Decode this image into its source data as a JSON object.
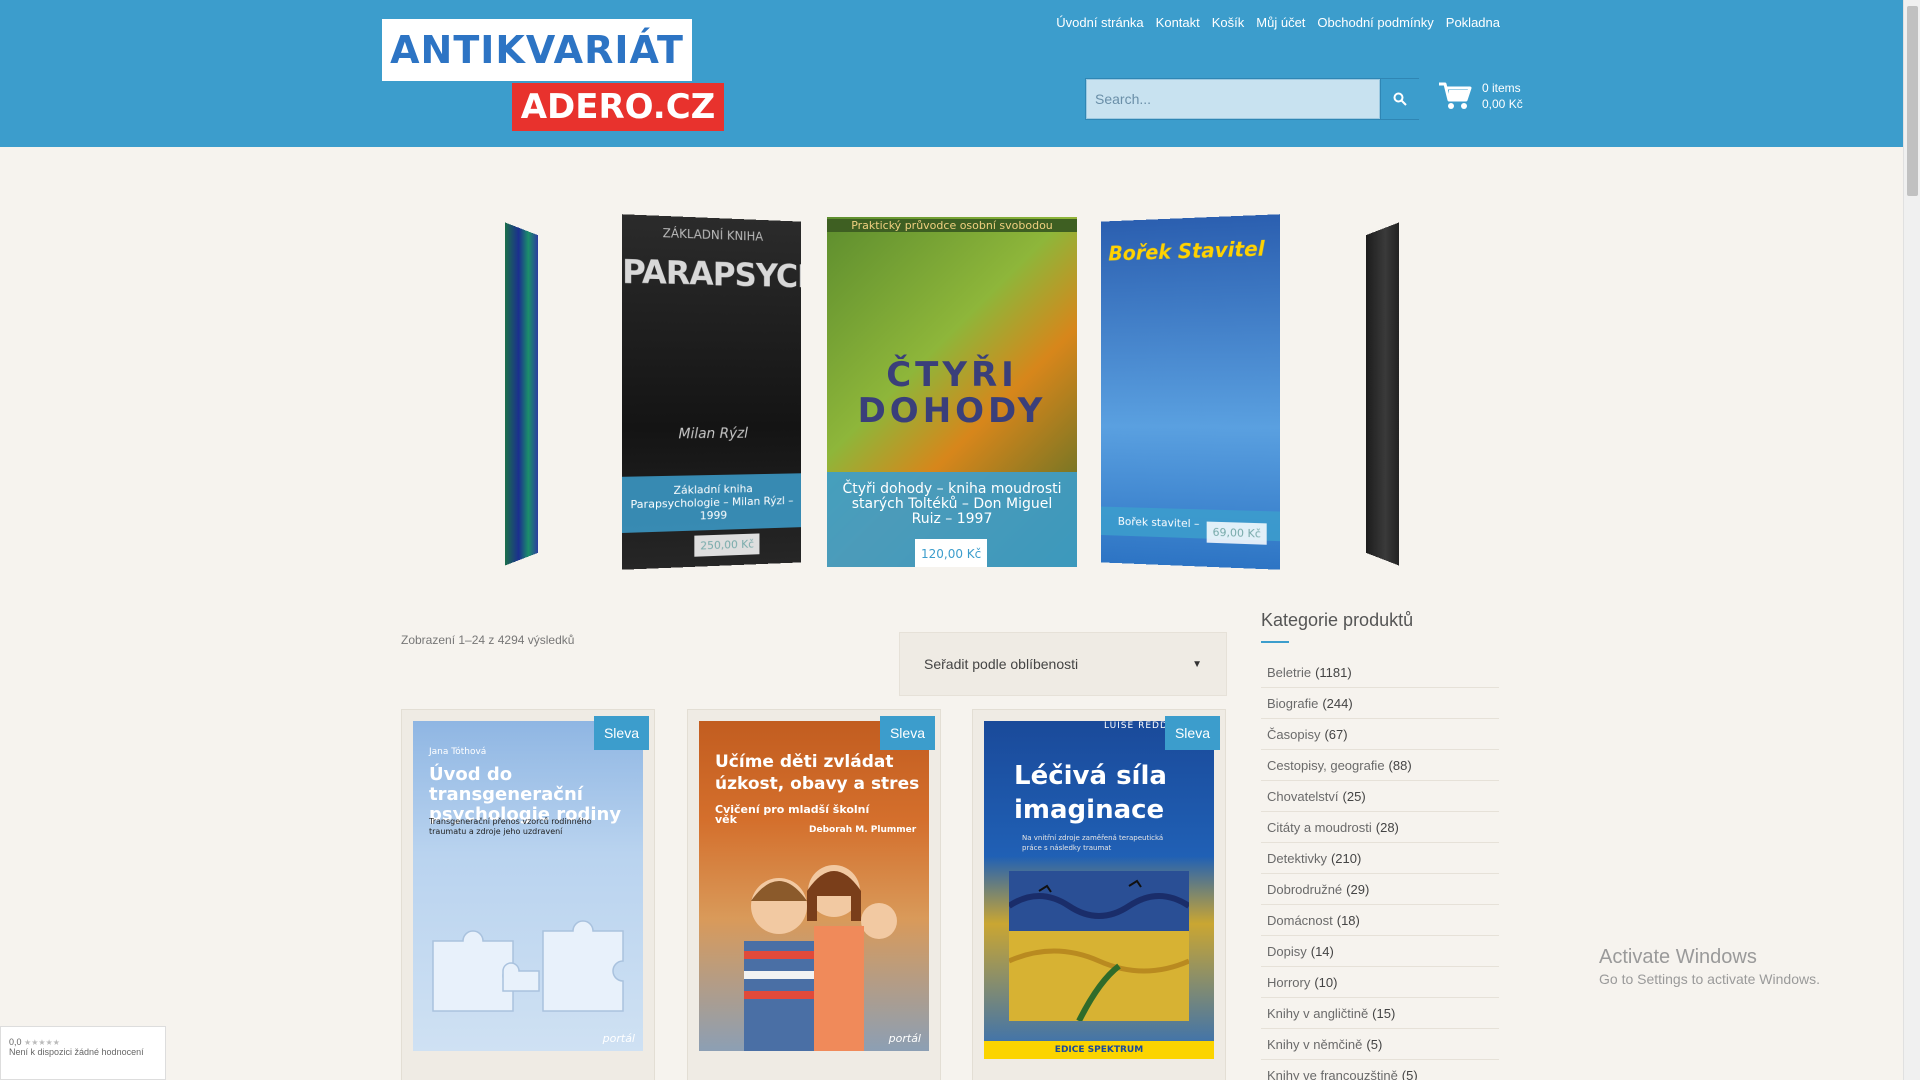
{
  "logo": {
    "line1": "ANTIKVARIÁT",
    "line2": "ADERO.CZ"
  },
  "nav": [
    "Úvodní stránka",
    "Kontakt",
    "Košík",
    "Můj účet",
    "Obchodní podmínky",
    "Pokladna"
  ],
  "search": {
    "placeholder": "Search..."
  },
  "cart": {
    "items": "0 items",
    "total": "0,00 Kč"
  },
  "carousel": {
    "left": {
      "series": "ZÁKLADNÍ KNIHA",
      "cover_title": "PARAPSYCHOLOGIE",
      "cover_author": "Milan Rýzl",
      "caption": "Základní kniha Parapsychologie – Milan Rýzl – 1999",
      "price": "250,00 Kč"
    },
    "center": {
      "cover_top": "Praktický průvodce osobní svobodou",
      "cover_title": "ČTYŘI DOHODY",
      "caption": "Čtyři dohody – kniha moudrosti starých Toltéků – Don Miguel Ruiz – 1997",
      "price": "120,00 Kč"
    },
    "right": {
      "cover_title": "Bořek Stavitel",
      "caption": "Bořek stavitel –",
      "price": "69,00 Kč"
    }
  },
  "results": {
    "count": "Zobrazení 1–24 z 4294 výsledků"
  },
  "orderby": {
    "selected": "Seřadit podle oblíbenosti"
  },
  "products": [
    {
      "badge": "Sleva",
      "cover_author": "Jana Tóthová",
      "cover_title": "Úvod do transgenerační psychologie rodiny",
      "cover_sub": "Transgenerační přenos vzorců rodinného traumatu a zdroje jeho uzdravení",
      "publisher": "portál"
    },
    {
      "badge": "Sleva",
      "cover_title": "Učíme děti zvládat úzkost, obavy a stres",
      "cover_sub": "Cvičení pro mladší školní věk",
      "cover_author2": "Deborah M. Plummer",
      "publisher": "portál"
    },
    {
      "badge": "Sleva",
      "cover_top": "LUISE REDD",
      "cover_title": "Léčivá síla imaginace",
      "cover_sub": "Na vnitřní zdroje zaměřená terapeutická práce s následky traumat",
      "cover_bottom": "EDICE SPEKTRUM"
    }
  ],
  "sidebar": {
    "title": "Kategorie produktů",
    "categories": [
      {
        "name": "Beletrie",
        "count": "(1181)"
      },
      {
        "name": "Biografie",
        "count": "(244)"
      },
      {
        "name": "Časopisy",
        "count": "(67)"
      },
      {
        "name": "Cestopisy, geografie",
        "count": "(88)"
      },
      {
        "name": "Chovatelství",
        "count": "(25)"
      },
      {
        "name": "Citáty a moudrosti",
        "count": "(28)"
      },
      {
        "name": "Detektivky",
        "count": "(210)"
      },
      {
        "name": "Dobrodružné",
        "count": "(29)"
      },
      {
        "name": "Domácnost",
        "count": "(18)"
      },
      {
        "name": "Dopisy",
        "count": "(14)"
      },
      {
        "name": "Horrory",
        "count": "(10)"
      },
      {
        "name": "Knihy v angličtině",
        "count": "(15)"
      },
      {
        "name": "Knihy v němčině",
        "count": "(5)"
      },
      {
        "name": "Knihy ve francouzštině",
        "count": "(5)"
      }
    ]
  },
  "rating_widget": {
    "score": "0,0",
    "text": "Není k dispozici žádné hodnocení"
  },
  "windows_notice": {
    "title": "Activate Windows",
    "subtitle": "Go to Settings to activate Windows."
  },
  "colors": {
    "header": "#3c9dcc",
    "accent": "#3c9dcc",
    "logo_red": "#e8322d",
    "background": "#f6f3ee"
  }
}
